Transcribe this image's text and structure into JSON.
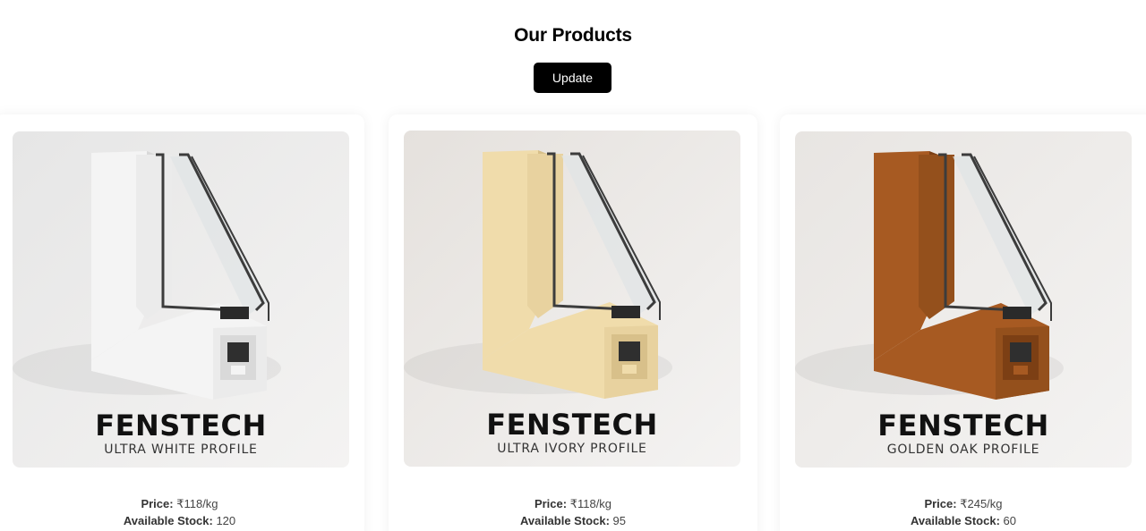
{
  "page": {
    "title": "Our Products",
    "update_label": "Update"
  },
  "labels": {
    "price": "Price:",
    "stock": "Available Stock:"
  },
  "products": [
    {
      "brand": "FENSTECH",
      "variant": "ULTRA WHITE PROFILE",
      "price": "₹118/kg",
      "stock": "120",
      "colors": {
        "bg": "#e6e6e6",
        "profile": "#f4f4f4",
        "profile_dark": "#d9d9d9",
        "profile_mid": "#ebebeb"
      }
    },
    {
      "brand": "FENSTECH",
      "variant": "ULTRA IVORY PROFILE",
      "price": "₹118/kg",
      "stock": "95",
      "colors": {
        "bg": "#e5e1dd",
        "profile": "#f0dcab",
        "profile_dark": "#d8c08a",
        "profile_mid": "#e8d29f"
      }
    },
    {
      "brand": "FENSTECH",
      "variant": "GOLDEN OAK PROFILE",
      "price": "₹245/kg",
      "stock": "60",
      "colors": {
        "bg": "#e8e5e2",
        "profile": "#a75a22",
        "profile_dark": "#7c3f14",
        "profile_mid": "#94501c"
      }
    }
  ]
}
